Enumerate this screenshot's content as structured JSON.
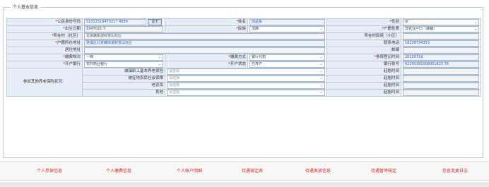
{
  "section_title": "个人基本信息",
  "row1": {
    "id_label": "公民身份号码",
    "id_value": "51022519470217 4880",
    "read_button": "读卡",
    "name_label": "姓名",
    "name_value": "周孟系",
    "gender_label": "性别",
    "gender_value": "女"
  },
  "row2": {
    "birth_label": "出生日期",
    "birth_value": "1947021 7",
    "ethnic_label": "民族",
    "ethnic_value": "汉族",
    "hukou_type_label": "户籍性质",
    "hukou_type_value": "非农业户口（城镇）"
  },
  "row3": {
    "village_label": "所在村（社区）",
    "village_value": "北京路街道秋雪山社区",
    "group_label": "所在村民组（小区）"
  },
  "row4": {
    "hukou_addr_label": "户籍所在地址",
    "hukou_addr_value": "遂溪区北京路街道秋雪山社区",
    "phone_label": "联系电话",
    "phone_value": "18228734353"
  },
  "row5": {
    "residence_label": "居住地址",
    "postcode_label": "邮编"
  },
  "row6": {
    "grade_label": "缴费档次",
    "grade_value": "一档",
    "pay_method_label": "缴费方式",
    "pay_method_value": "银行代扣",
    "enroll_date_label": "参保登记时间",
    "enroll_date_value": "20120719"
  },
  "row7": {
    "bank_label": "开户银行",
    "bank_value": "农村商业银行",
    "acct_status_label": "开户状态",
    "acct_status_value": "已开户",
    "acct_no_label": "银行账号",
    "acct_no_value": "62295381008001823 76"
  },
  "other_insurance": {
    "group_label": "参加其他养老保险状况：",
    "select_placeholder": "请选择",
    "time_label": "起始时间",
    "items": [
      {
        "label": "城镇职工基本养老保险"
      },
      {
        "label": "被征地农民社会保障"
      },
      {
        "label": "老农保"
      },
      {
        "label": "其他"
      }
    ]
  },
  "bottom_links": [
    "个人参保信息",
    "个人缴费信息",
    "个人账户明细",
    "待遇核定表",
    "待遇发放信息",
    "待遇暂停核定",
    "信息变更日志"
  ],
  "icons": {
    "dropdown": "chevron-down-icon"
  }
}
